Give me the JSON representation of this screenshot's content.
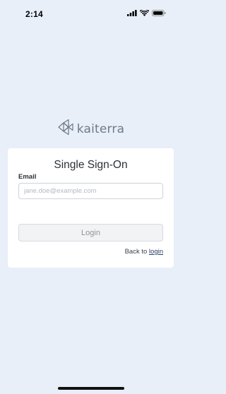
{
  "status_bar": {
    "time": "2:14",
    "icons": [
      "cellular-signal-icon",
      "wifi-icon",
      "battery-icon"
    ]
  },
  "logo": {
    "text": "kaiterra",
    "icon": "kaiterra-logo-icon"
  },
  "card": {
    "title": "Single Sign-On",
    "email_label": "Email",
    "email_placeholder": "jane.doe@example.com",
    "email_value": "",
    "login_label": "Login",
    "back_prefix": "Back to",
    "back_link": "login"
  },
  "colors": {
    "background": "#e9eff9",
    "card": "#ffffff",
    "link": "#2b3e68",
    "logo": "#6d7a88"
  }
}
